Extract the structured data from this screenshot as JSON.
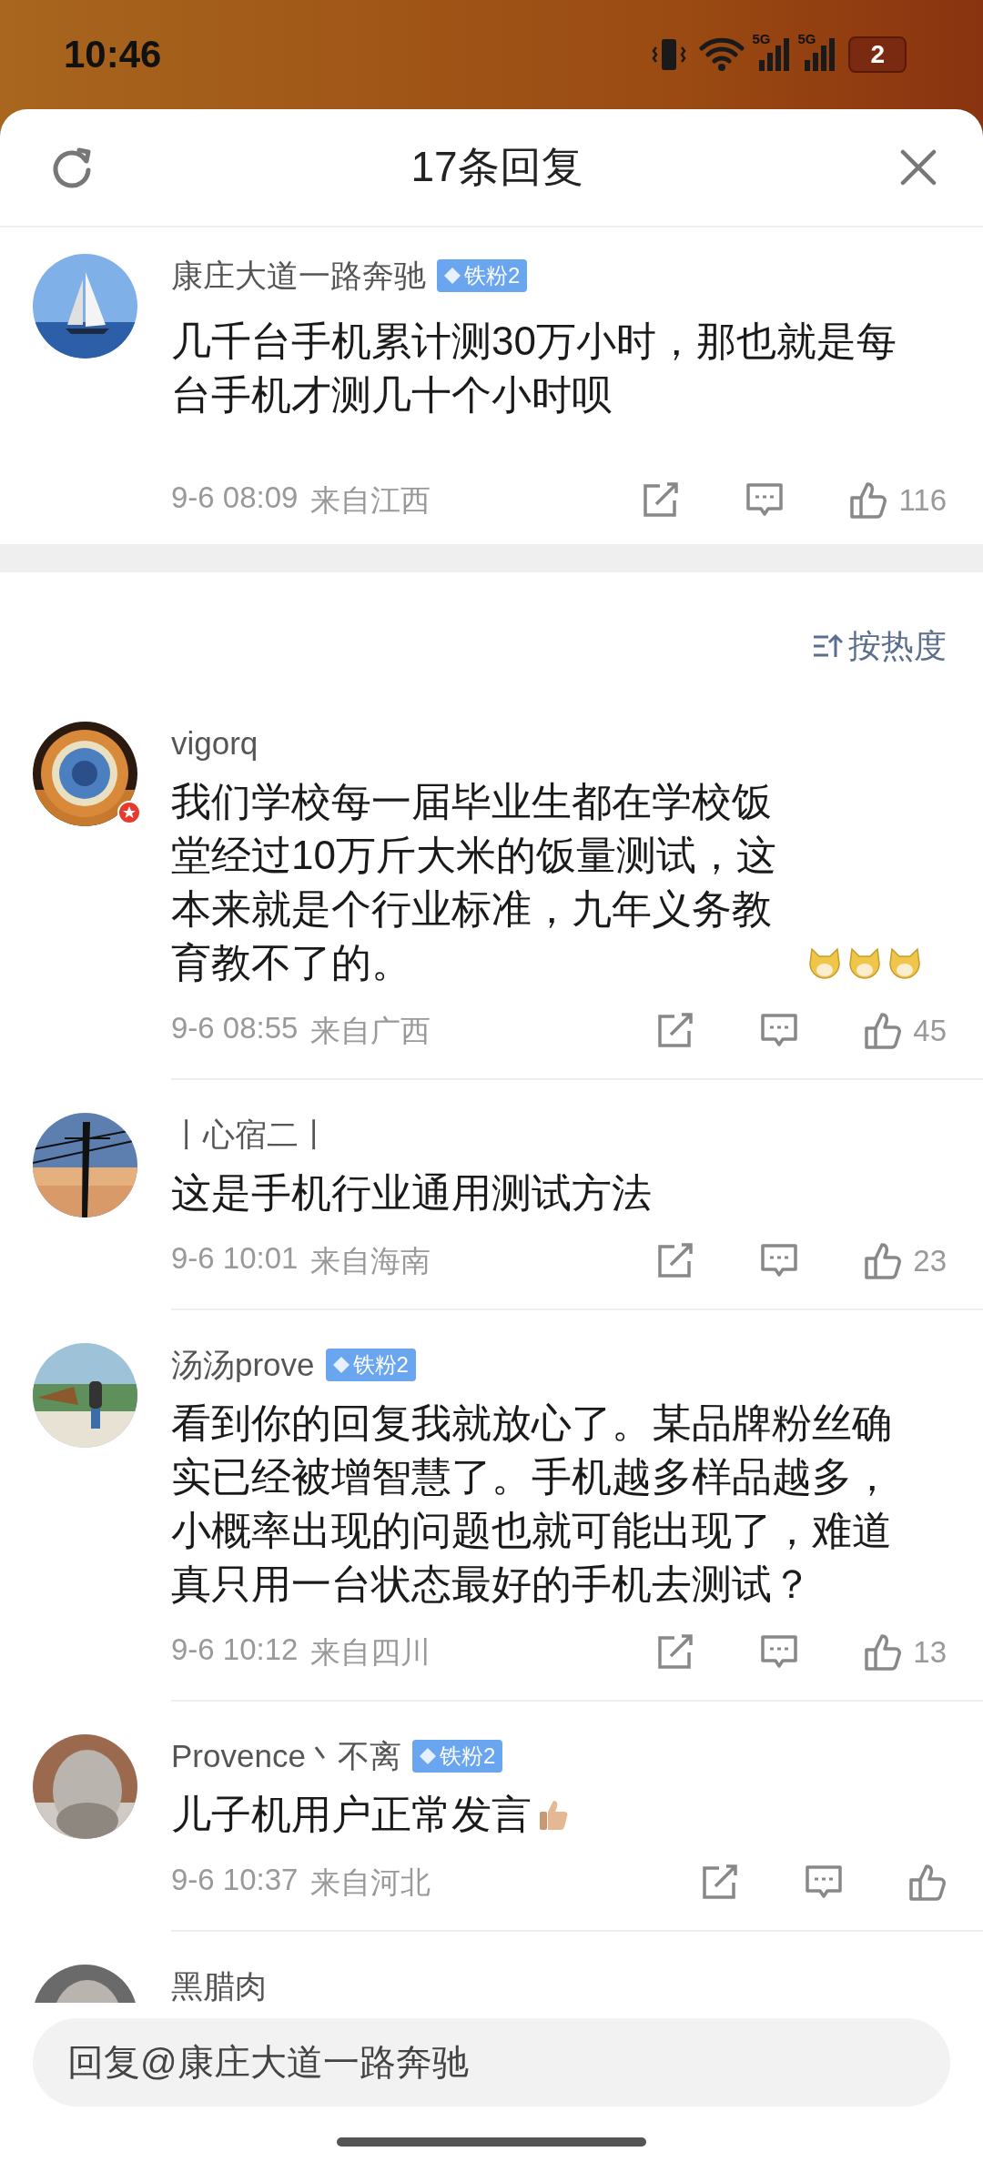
{
  "status_bar": {
    "time": "10:46",
    "networks": [
      "5G",
      "5G"
    ],
    "battery": "2"
  },
  "header": {
    "title": "17条回复"
  },
  "thread": {
    "author": "康庄大道一路奔驰",
    "badge": "铁粉2",
    "verified": false,
    "text": "几千台手机累计测30万小时，那也就是每台手机才测几十个小时呗",
    "time": "9-6 08:09",
    "location": "来自江西",
    "likes": "116"
  },
  "sort": {
    "label": "按热度"
  },
  "replies": [
    {
      "author": "vigorq",
      "verified": true,
      "text": "我们学校每一届毕业生都在学校饭堂经过10万斤大米的饭量测试，这本来就是个行业标准，九年义务教育教不了的。",
      "stickers": [
        {
          "kind": "dog"
        },
        {
          "kind": "dog"
        },
        {
          "kind": "dog"
        }
      ],
      "time": "9-6 08:55",
      "location": "来自广西",
      "likes": "45"
    },
    {
      "author": "丨心宿二丨",
      "verified": false,
      "text": "这是手机行业通用测试方法",
      "time": "9-6 10:01",
      "location": "来自海南",
      "likes": "23"
    },
    {
      "author": "汤汤prove",
      "badge": "铁粉2",
      "verified": false,
      "text": "看到你的回复我就放心了。某品牌粉丝确实已经被增智慧了。手机越多样品越多，小概率出现的问题也就可能出现了，难道真只用一台状态最好的手机去测试？",
      "time": "9-6 10:12",
      "location": "来自四川",
      "likes": "13"
    },
    {
      "author": "Provence丶不离",
      "badge": "铁粉2",
      "verified": false,
      "text": "儿子机用户正常发言",
      "stickers": [
        {
          "kind": "thumbs_up"
        }
      ],
      "time": "9-6 10:37",
      "location": "来自河北"
    },
    {
      "author": "黑腊肉",
      "verified": false
    }
  ],
  "reply_box": {
    "placeholder": "回复@康庄大道一路奔驰"
  }
}
